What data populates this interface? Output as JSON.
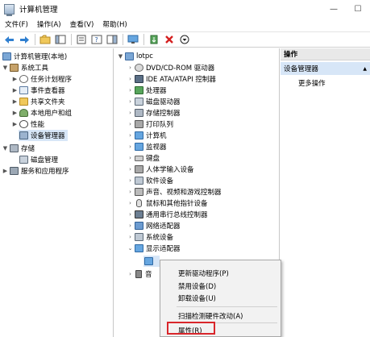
{
  "window": {
    "title": "计算机管理",
    "minimize": "—",
    "maximize": "☐"
  },
  "menu": [
    "文件(F)",
    "操作(A)",
    "查看(V)",
    "帮助(H)"
  ],
  "left_tree": {
    "root": "计算机管理(本地)",
    "system_tools": "系统工具",
    "task_scheduler": "任务计划程序",
    "event_viewer": "事件查看器",
    "shared_folders": "共享文件夹",
    "local_users": "本地用户和组",
    "performance": "性能",
    "device_manager": "设备管理器",
    "storage": "存储",
    "disk_management": "磁盘管理",
    "services_apps": "服务和应用程序"
  },
  "device_tree": {
    "root": "lotpc",
    "items": [
      "DVD/CD-ROM 驱动器",
      "IDE ATA/ATAPI 控制器",
      "处理器",
      "磁盘驱动器",
      "存储控制器",
      "打印队列",
      "计算机",
      "监视器",
      "键盘",
      "人体学输入设备",
      "软件设备",
      "声音、视频和游戏控制器",
      "鼠标和其他指针设备",
      "通用串行总线控制器",
      "网络适配器",
      "系统设备",
      "显示适配器"
    ],
    "partial_item": "音"
  },
  "actions": {
    "header": "操作",
    "section": "设备管理器",
    "section_arrow": "▲",
    "more": "更多操作"
  },
  "context_menu": {
    "update_driver": "更新驱动程序(P)",
    "disable_device": "禁用设备(D)",
    "uninstall_device": "卸载设备(U)",
    "scan_hardware": "扫描检测硬件改动(A)",
    "properties": "属性(R)"
  },
  "colors": {
    "selection": "#d7e6f7",
    "highlight_box": "#d9262b",
    "actions_header": "#e9e9e9"
  }
}
